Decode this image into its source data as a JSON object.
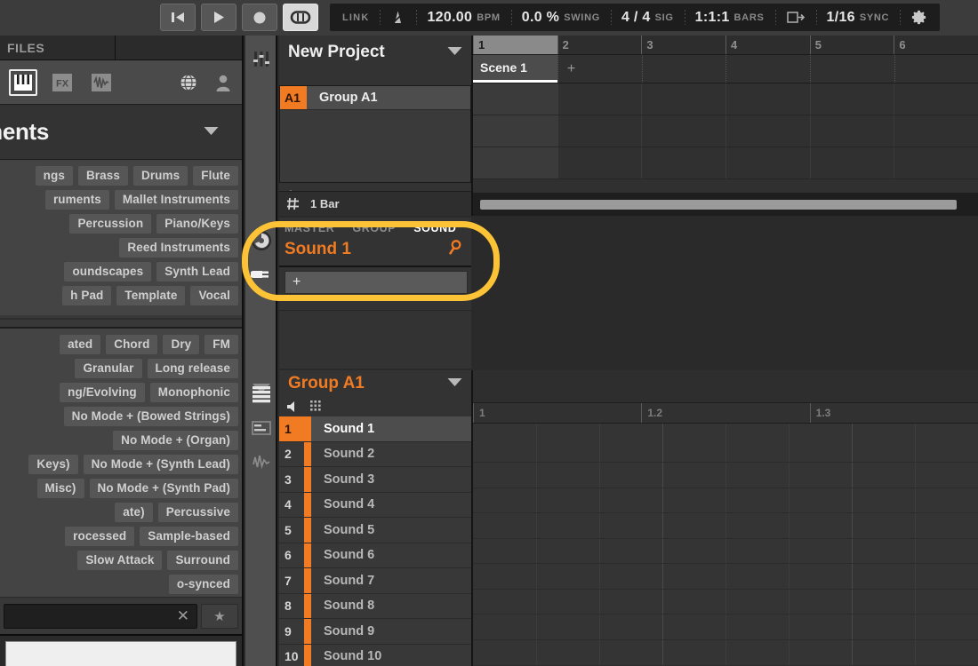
{
  "header": {
    "transport": [
      {
        "name": "restart-button",
        "icon": "skip-back-icon",
        "active": false
      },
      {
        "name": "play-button",
        "icon": "play-icon",
        "active": false
      },
      {
        "name": "record-button",
        "icon": "record-icon",
        "active": false
      },
      {
        "name": "loop-button",
        "icon": "loop-icon",
        "active": true
      }
    ],
    "status": {
      "link_label": "LINK",
      "metronome_icon": "metronome-icon",
      "tempo_value": "120.00",
      "tempo_unit": "BPM",
      "swing_value": "0.0 %",
      "swing_unit": "SWING",
      "signature_value": "4 / 4",
      "signature_unit": "SIG",
      "position_value": "1:1:1",
      "position_unit": "BARS",
      "follow_icon": "follow-playhead-icon",
      "quantize_value": "1/16",
      "quantize_unit": "SYNC",
      "settings_icon": "gear-icon"
    }
  },
  "browser": {
    "tabs": [
      {
        "label": "FILES"
      },
      {
        "label": ""
      }
    ],
    "type_icons": [
      {
        "name": "instrument-icon",
        "selected": true
      },
      {
        "name": "fx-icon",
        "label": "FX",
        "selected": false
      },
      {
        "name": "waveform-icon",
        "selected": false
      }
    ],
    "right_icons": [
      {
        "name": "globe-icon"
      },
      {
        "name": "user-icon"
      }
    ],
    "title": "ments",
    "dropdown_icon": "chevron-down-icon",
    "tag_group_1": [
      [
        "ngs",
        "Brass",
        "Drums",
        "Flute"
      ],
      [
        "ruments",
        "Mallet Instruments"
      ],
      [
        "Percussion",
        "Piano/Keys"
      ],
      [
        "Reed Instruments"
      ],
      [
        "oundscapes",
        "Synth Lead"
      ],
      [
        "h Pad",
        "Template",
        "Vocal"
      ]
    ],
    "tag_group_2": [
      [
        "ated",
        "Chord",
        "Dry",
        "FM"
      ],
      [
        "Granular",
        "Long release"
      ],
      [
        "ng/Evolving",
        "Monophonic"
      ],
      [
        "No Mode + (Bowed Strings)"
      ],
      [
        "No Mode + (Organ)"
      ],
      [
        "Keys)",
        "No Mode + (Synth Lead)"
      ],
      [
        "Misc)",
        "No Mode + (Synth Pad)"
      ],
      [
        "ate)",
        "Percussive"
      ],
      [
        "rocessed",
        "Sample-based"
      ],
      [
        "Slow Attack",
        "Surround"
      ],
      [
        "o-synced"
      ]
    ],
    "search": {
      "value": "",
      "clear_icon": "close-icon",
      "favorite_icon": "star-icon"
    }
  },
  "rail": {
    "top_icons": [
      {
        "name": "mixer-icon"
      }
    ],
    "mid_icons": [
      {
        "name": "macro-knob-icon"
      },
      {
        "name": "plugin-icon"
      },
      {
        "name": "collapse-icon"
      }
    ],
    "bottom_icons": [
      {
        "name": "pattern-list-icon"
      },
      {
        "name": "keyboard-icon"
      },
      {
        "name": "automation-icon"
      }
    ]
  },
  "arranger": {
    "project_title": "New Project",
    "dropdown_icon": "chevron-down-icon",
    "groups": [
      {
        "index": "A1",
        "name": "Group A1"
      }
    ],
    "add_label": "+",
    "footer": {
      "grid_icon": "grid-icon",
      "length_label": "1 Bar"
    }
  },
  "sound_panel": {
    "tabs": [
      {
        "label": "MASTER",
        "active": false
      },
      {
        "label": "GROUP",
        "active": false
      },
      {
        "label": "SOUND",
        "active": true
      }
    ],
    "name": "Sound 1",
    "browse_icon": "magnifier-icon",
    "slots": [
      {
        "label": "+"
      }
    ]
  },
  "sound_list": {
    "group_title": "Group A1",
    "dropdown_icon": "chevron-down-icon",
    "tools": [
      {
        "name": "speaker-icon"
      },
      {
        "name": "pad-grid-icon"
      }
    ],
    "sounds": [
      {
        "index": "1",
        "name": "Sound 1",
        "selected": true
      },
      {
        "index": "2",
        "name": "Sound 2",
        "selected": false
      },
      {
        "index": "3",
        "name": "Sound 3",
        "selected": false
      },
      {
        "index": "4",
        "name": "Sound 4",
        "selected": false
      },
      {
        "index": "5",
        "name": "Sound 5",
        "selected": false
      },
      {
        "index": "6",
        "name": "Sound 6",
        "selected": false
      },
      {
        "index": "7",
        "name": "Sound 7",
        "selected": false
      },
      {
        "index": "8",
        "name": "Sound 8",
        "selected": false
      },
      {
        "index": "9",
        "name": "Sound 9",
        "selected": false
      },
      {
        "index": "10",
        "name": "Sound 10",
        "selected": false
      }
    ]
  },
  "timeline": {
    "bars": [
      {
        "label": "1",
        "current": true
      },
      {
        "label": "2",
        "current": false
      },
      {
        "label": "3",
        "current": false
      },
      {
        "label": "4",
        "current": false
      },
      {
        "label": "5",
        "current": false
      },
      {
        "label": "6",
        "current": false
      }
    ],
    "scene_name": "Scene 1",
    "scene_add_label": "+"
  },
  "pattern_editor": {
    "ruler": [
      {
        "label": "1"
      },
      {
        "label": "1.2"
      },
      {
        "label": "1.3"
      }
    ]
  },
  "highlight": {
    "color": "#fcc336",
    "target": "sound-panel"
  },
  "colors": {
    "accent_orange": "#f07b22",
    "highlight_yellow": "#fcc336",
    "panel_bg": "#333333",
    "header_bg": "#3c3c3c"
  }
}
